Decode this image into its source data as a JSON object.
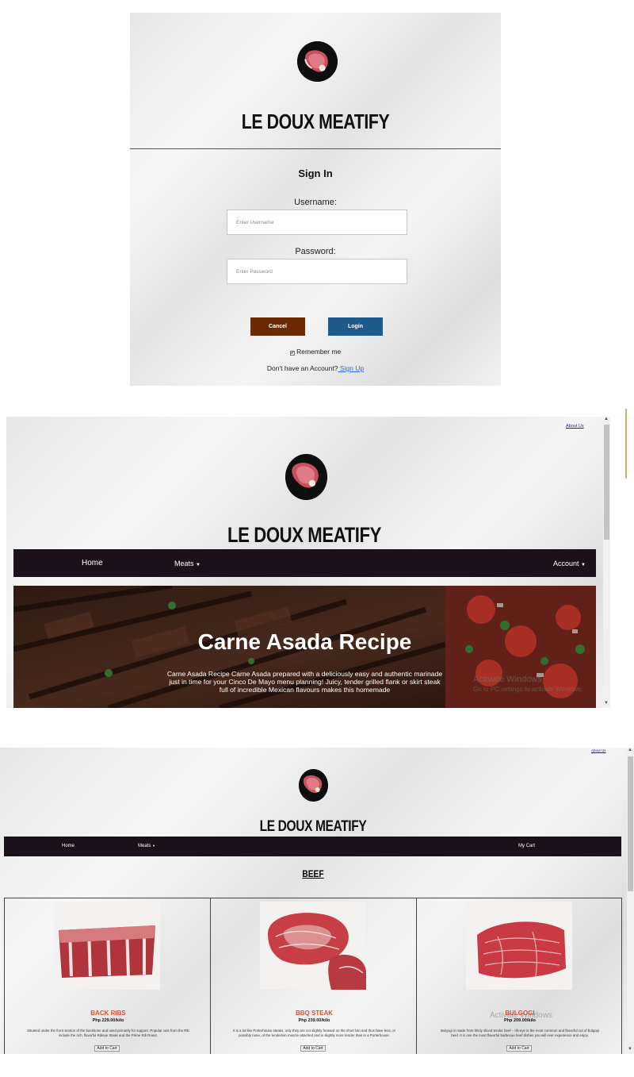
{
  "brand": {
    "name": "LE DOUX MEATIFY"
  },
  "signin": {
    "title": "Sign In",
    "username_label": "Username:",
    "username_placeholder": "Enter Username",
    "password_label": "Password:",
    "password_placeholder": "Enter Password",
    "cancel_label": "Cancel",
    "login_label": "Login",
    "remember_label": "Remember me",
    "remember_checked": true,
    "no_account_text": "Don't have an Account?",
    "signup_label": " Sign Up",
    "colors": {
      "cancel": "#6b2a06",
      "login": "#1e5b8a"
    }
  },
  "home": {
    "about_link": "About Us",
    "nav": {
      "home": "Home",
      "meats": "Meats",
      "account": "Account"
    },
    "hero": {
      "title": "Carne Asada Recipe",
      "text_line1": "Carne Asada Recipe Carne Asada prepared with a deliciously easy and authentic marinade",
      "text_line2": "just in time for your Cinco De Mayo menu planning! Juicy, tender grilled flank or skirt steak",
      "text_line3": "full of incredible Mexican flavours makes this homemade"
    },
    "watermark": {
      "line1": "Activate Windows",
      "line2": "Go to PC settings to activate Windows."
    },
    "colors": {
      "nav": "#1b111b"
    }
  },
  "beef": {
    "about_link": "About Us",
    "nav": {
      "home": "Home",
      "meats": "Meats",
      "cart": "My Cart"
    },
    "section_title": "BEEF",
    "products": [
      {
        "name": "BACK RIBS",
        "price": "Php 229.00/kilo",
        "desc1": "Situated under the front section of the backbone and used primarily for support. Popular cuts from the Rib",
        "desc2": "include the rich, flavorful Ribeye Steak and the Prime Rib Roast.",
        "button": "Add to Cart"
      },
      {
        "name": "BBQ STEAK",
        "price": "Php 239.00/kilo",
        "desc1": "It is a lot like Porterhouse steaks, only they are cut slightly forward on the short loin and thus have less, or",
        "desc2": "possibly none, of the tenderloin muscle attached and is slightly more tender than in a Porterhouse.",
        "button": "Add to Cart"
      },
      {
        "name": "BULGOGI",
        "price": "Php 209.00/kilo",
        "desc1": "Bulgogi is made from thinly sliced tender beef – rib-eye is the most common and flavorful cut of bulgogi",
        "desc2": "beef. It is one the most flavorful barbecue beef dishes you will ever experience and enjoy.",
        "button": "Add to Cart"
      }
    ],
    "watermark": {
      "line1": "Activate Windows"
    }
  }
}
